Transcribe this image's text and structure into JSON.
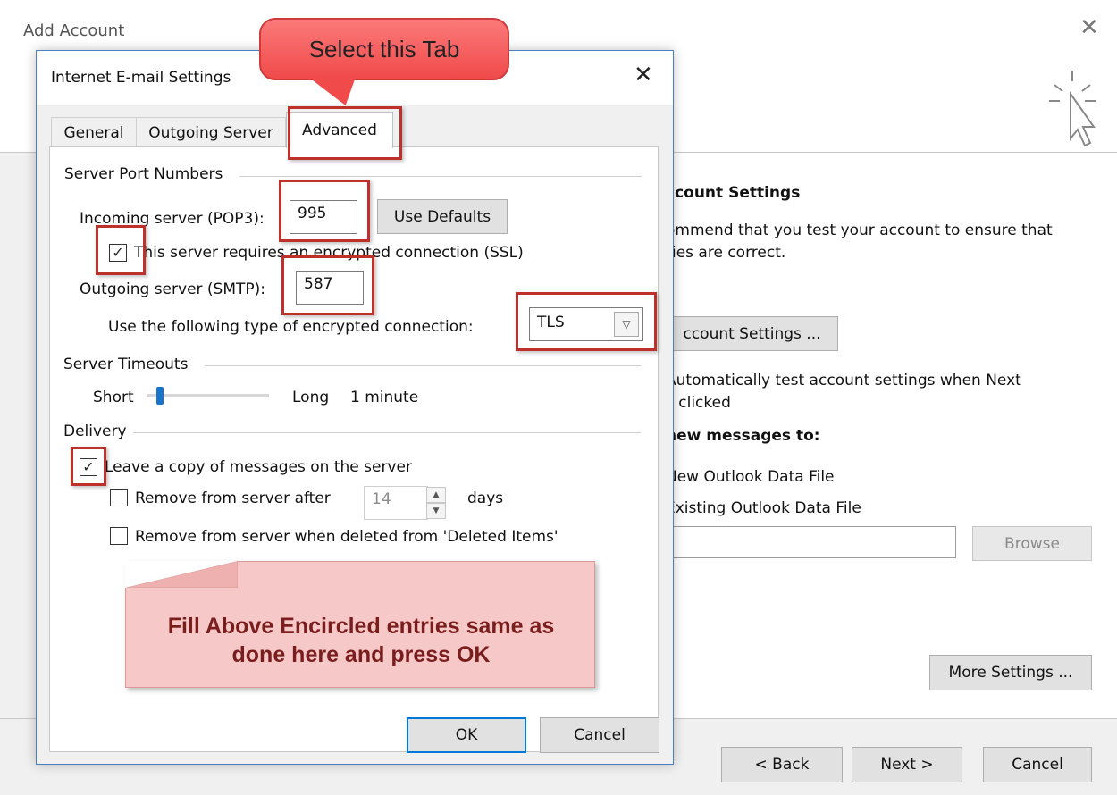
{
  "background_window": {
    "title": "Add Account",
    "section_heading": "ccount Settings",
    "recommend_line1": "ommend that you test your account to ensure that",
    "recommend_line2": "ries are correct.",
    "account_settings_button": "ccount Settings ...",
    "auto_test_line1": "Automatically test account settings when Next",
    "auto_test_line2": "s clicked",
    "deliver_heading": "new messages to:",
    "new_data_file": "New Outlook Data File",
    "existing_data_file": "Existing Outlook Data File",
    "browse_button": "Browse",
    "more_settings_button": "More Settings ...",
    "back_button": "< Back",
    "next_button": "Next >",
    "cancel_button": "Cancel"
  },
  "dialog": {
    "title": "Internet E-mail Settings",
    "tabs": [
      {
        "label": "General",
        "active": false
      },
      {
        "label": "Outgoing Server",
        "active": false
      },
      {
        "label": "Advanced",
        "active": true
      }
    ],
    "server_port_numbers": {
      "heading": "Server Port Numbers",
      "incoming_label": "Incoming server (POP3):",
      "incoming_value": "995",
      "use_defaults_button": "Use Defaults",
      "ssl_label": "This server requires an encrypted connection (SSL)",
      "ssl_checked": true,
      "outgoing_label": "Outgoing server (SMTP):",
      "outgoing_value": "587",
      "encryption_label": "Use the following type of encrypted connection:",
      "encryption_value": "TLS"
    },
    "server_timeouts": {
      "heading": "Server Timeouts",
      "short_label": "Short",
      "long_label": "Long",
      "value_label": "1 minute",
      "slider_fraction": 0.1
    },
    "delivery": {
      "heading": "Delivery",
      "leave_copy_label": "Leave a copy of messages on the server",
      "leave_copy_checked": true,
      "remove_after_label": "Remove from server after",
      "remove_after_checked": false,
      "remove_after_days": "14",
      "days_label": "days",
      "remove_deleted_label": "Remove from server when deleted from 'Deleted Items'",
      "remove_deleted_checked": false
    },
    "ok_button": "OK",
    "cancel_button": "Cancel"
  },
  "annotations": {
    "top_callout": "Select this Tab",
    "bottom_callout_line1": "Fill Above Encircled entries same as",
    "bottom_callout_line2": "done here and press OK",
    "highlight_color": "#c0302a"
  },
  "checkmark_glyph": "✓",
  "icons": [
    "close-icon",
    "cursor-click-icon",
    "chevron-down-icon",
    "spinner-up-icon",
    "spinner-down-icon"
  ]
}
